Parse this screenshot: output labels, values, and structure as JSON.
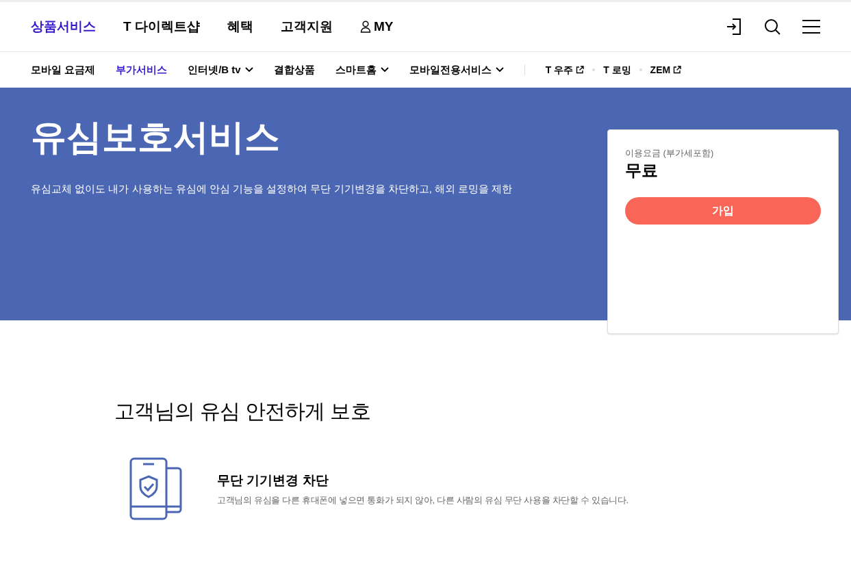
{
  "main_nav": [
    {
      "label": "상품서비스",
      "selected": true,
      "kind": "text"
    },
    {
      "label": "T 다이렉트샵",
      "selected": false,
      "kind": "text"
    },
    {
      "label": "혜택",
      "selected": false,
      "kind": "text"
    },
    {
      "label": "고객지원",
      "selected": false,
      "kind": "text"
    },
    {
      "label": "MY",
      "selected": false,
      "kind": "user"
    }
  ],
  "sub_nav": [
    {
      "label": "모바일 요금제",
      "selected": false,
      "kind": "plain"
    },
    {
      "label": "부가서비스",
      "selected": true,
      "kind": "plain"
    },
    {
      "label": "인터넷/B tv",
      "selected": false,
      "kind": "dropdown"
    },
    {
      "label": "결합상품",
      "selected": false,
      "kind": "plain"
    },
    {
      "label": "스마트홈",
      "selected": false,
      "kind": "dropdown"
    },
    {
      "label": "모바일전용서비스",
      "selected": false,
      "kind": "dropdown"
    }
  ],
  "external_links": [
    {
      "label": "T 우주",
      "external": true
    },
    {
      "label": "T 로밍",
      "external": false
    },
    {
      "label": "ZEM",
      "external": true
    }
  ],
  "hero": {
    "title": "유심보호서비스",
    "description": "유심교체 없이도 내가 사용하는 유심에 안심 기능을 설정하여 무단 기기변경을 차단하고, 해외 로밍을 제한"
  },
  "price_card": {
    "label": "이용요금 (부가세포함)",
    "price": "무료",
    "button": "가입"
  },
  "section": {
    "title": "고객님의 유심 안전하게 보호",
    "features": [
      {
        "title": "무단 기기변경 차단",
        "description": "고객님의 유심을 다른 휴대폰에 넣으면 통화가 되지 않아, 다른 사람의 유심 무단 사용을 차단할 수 있습니다."
      }
    ]
  }
}
